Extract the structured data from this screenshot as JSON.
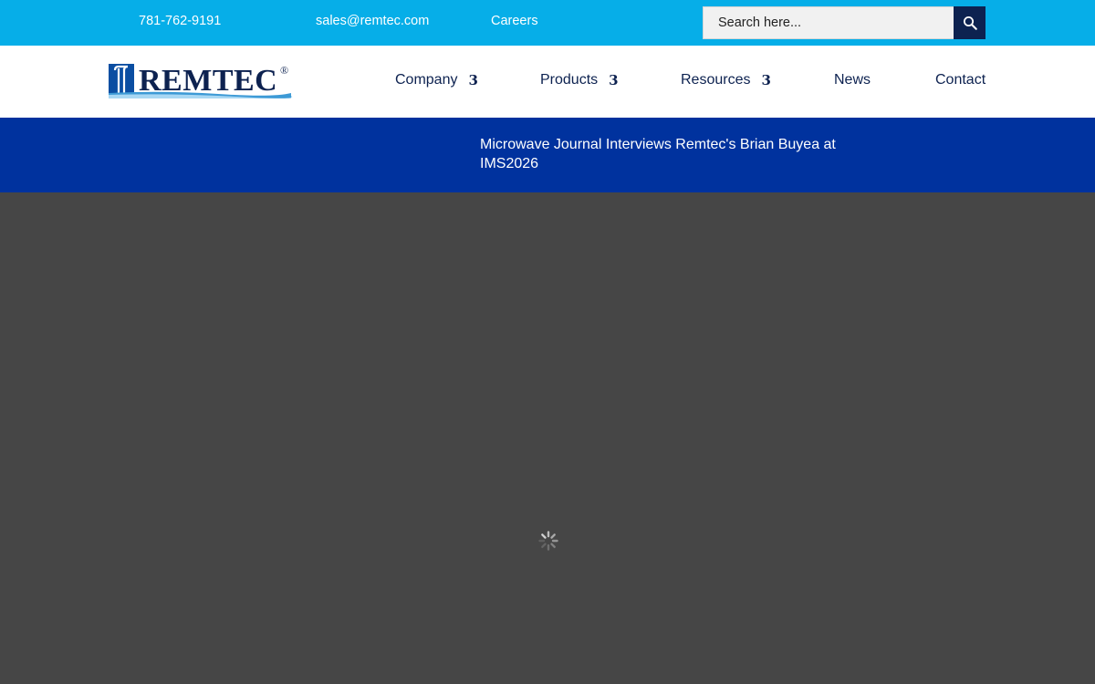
{
  "topbar": {
    "phone": "781-762-9191",
    "email": "sales@remtec.com",
    "careers": "Careers",
    "search_placeholder": "Search here...",
    "search_icon": "search-icon"
  },
  "header": {
    "logo_text": "REMTEC",
    "logo_mark": "®",
    "nav": {
      "company": "Company",
      "products": "Products",
      "resources": "Resources",
      "news": "News",
      "contact": "Contact",
      "dropdown_glyph": "3"
    }
  },
  "banner": {
    "headline": "Microwave Journal Interviews Remtec's Brian Buyea at IMS2026"
  },
  "main": {
    "loading_icon": "loading-spinner-icon"
  },
  "colors": {
    "topbar": "#06aee8",
    "nav_text": "#0d2250",
    "banner": "#00329e",
    "content_bg": "#464646",
    "search_button": "#0d2250"
  }
}
